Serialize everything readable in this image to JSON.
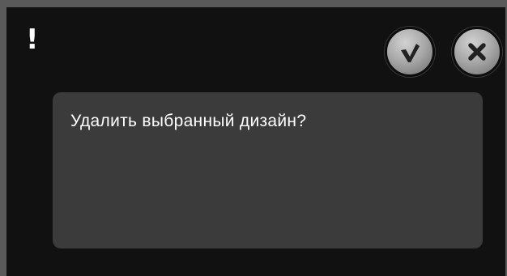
{
  "dialog": {
    "alert_symbol": "!",
    "message": "Удалить выбранный дизайн?",
    "confirm_icon": "checkmark-icon",
    "cancel_icon": "close-icon"
  },
  "colors": {
    "background": "#111111",
    "frame": "#5a5a5a",
    "message_box": "#3b3b3b",
    "button_face": "#a7a7a7",
    "icon": "#222222",
    "text": "#ffffff"
  }
}
